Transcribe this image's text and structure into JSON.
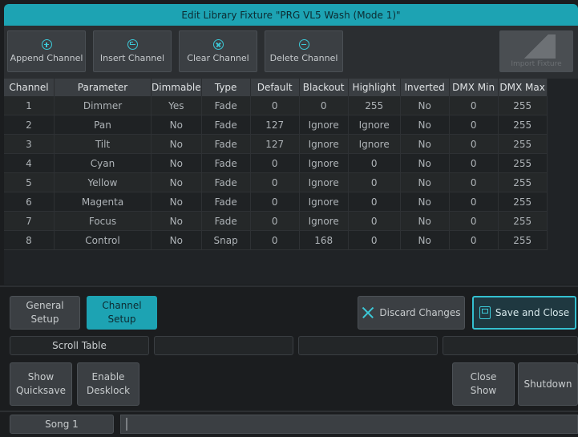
{
  "window": {
    "title": "Edit Library Fixture \"PRG VL5 Wash (Mode 1)\""
  },
  "toolbar": {
    "append_label": "Append Channel",
    "insert_label": "Insert Channel",
    "clear_label": "Clear Channel",
    "delete_label": "Delete Channel",
    "disabled_label": "Import Fixture"
  },
  "table": {
    "columns": [
      "Channel",
      "Parameter",
      "Dimmable",
      "Type",
      "Default",
      "Blackout",
      "Highlight",
      "Inverted",
      "DMX Min",
      "DMX Max"
    ],
    "rows": [
      [
        "1",
        "Dimmer",
        "Yes",
        "Fade",
        "0",
        "0",
        "255",
        "No",
        "0",
        "255"
      ],
      [
        "2",
        "Pan",
        "No",
        "Fade",
        "127",
        "Ignore",
        "Ignore",
        "No",
        "0",
        "255"
      ],
      [
        "3",
        "Tilt",
        "No",
        "Fade",
        "127",
        "Ignore",
        "Ignore",
        "No",
        "0",
        "255"
      ],
      [
        "4",
        "Cyan",
        "No",
        "Fade",
        "0",
        "Ignore",
        "0",
        "No",
        "0",
        "255"
      ],
      [
        "5",
        "Yellow",
        "No",
        "Fade",
        "0",
        "Ignore",
        "0",
        "No",
        "0",
        "255"
      ],
      [
        "6",
        "Magenta",
        "No",
        "Fade",
        "0",
        "Ignore",
        "0",
        "No",
        "0",
        "255"
      ],
      [
        "7",
        "Focus",
        "No",
        "Fade",
        "0",
        "Ignore",
        "0",
        "No",
        "0",
        "255"
      ],
      [
        "8",
        "Control",
        "No",
        "Snap",
        "0",
        "168",
        "0",
        "No",
        "0",
        "255"
      ]
    ]
  },
  "tabs": {
    "general": "General\nSetup",
    "channel": "Channel\nSetup"
  },
  "actions": {
    "discard": "Discard Changes",
    "save": "Save and Close"
  },
  "softkeys": [
    "Scroll Table",
    "",
    "",
    ""
  ],
  "bottom": {
    "show_quicksave": "Show\nQuicksave",
    "enable_desklock": "Enable\nDesklock",
    "close_show": "Close\nShow",
    "shutdown": "Shutdown"
  },
  "status": {
    "song": "Song 1"
  },
  "colors": {
    "accent": "#1da3b3",
    "background": "#1b1d1f"
  }
}
